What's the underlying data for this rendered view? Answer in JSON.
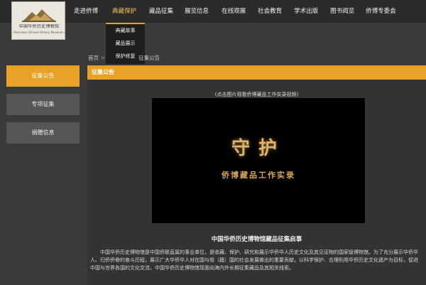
{
  "logo": {
    "name_cn": "中国华侨历史博物馆",
    "name_en": "Overseas Chinese History Museum of China"
  },
  "nav": {
    "items": [
      {
        "label": "走进侨博"
      },
      {
        "label": "典藏保护"
      },
      {
        "label": "藏品征集"
      },
      {
        "label": "展览信息"
      },
      {
        "label": "在线观展"
      },
      {
        "label": "社会教育"
      },
      {
        "label": "学术出版"
      },
      {
        "label": "图书阅览"
      },
      {
        "label": "侨博专委会"
      }
    ]
  },
  "dropdown": {
    "items": [
      {
        "label": "典藏故事"
      },
      {
        "label": "藏品展示"
      },
      {
        "label": "保护修复"
      }
    ]
  },
  "breadcrumb": {
    "home": "首页",
    "sep": ">",
    "current": "征集公告"
  },
  "sidebar": {
    "items": [
      {
        "label": "征集公告"
      },
      {
        "label": "专项征集"
      },
      {
        "label": "捐赠信息"
      }
    ]
  },
  "main": {
    "section_title": "征集公告",
    "video_caption": "(点击图片观看侨博藏品工作实录视频)",
    "video_title": "守护",
    "video_subtitle": "侨博藏品工作实录",
    "article_title": "中国华侨历史博物馆藏品征集启事",
    "article_body": "中国华侨历史博物馆是中国侨联直属的事业单位，是收藏、保护、研究和展示华侨华人历史文化及其见证物的国家级博物馆。为了充分展示华侨华人、归侨侨眷的奋斗历程，展示广大华侨华人对在国与祖（籍）国的社会发展做出的重要贡献，以科学保护、合理利用华侨历史文化遗产为目标，促进中国与世界各国的文化交流，中国华侨历史博物馆现面向海内外长期征集藏品及其相关线索。"
  },
  "colors": {
    "accent": "#e8a227",
    "nav_bg": "#2b2b2b",
    "page_bg": "#3a3a3a"
  }
}
